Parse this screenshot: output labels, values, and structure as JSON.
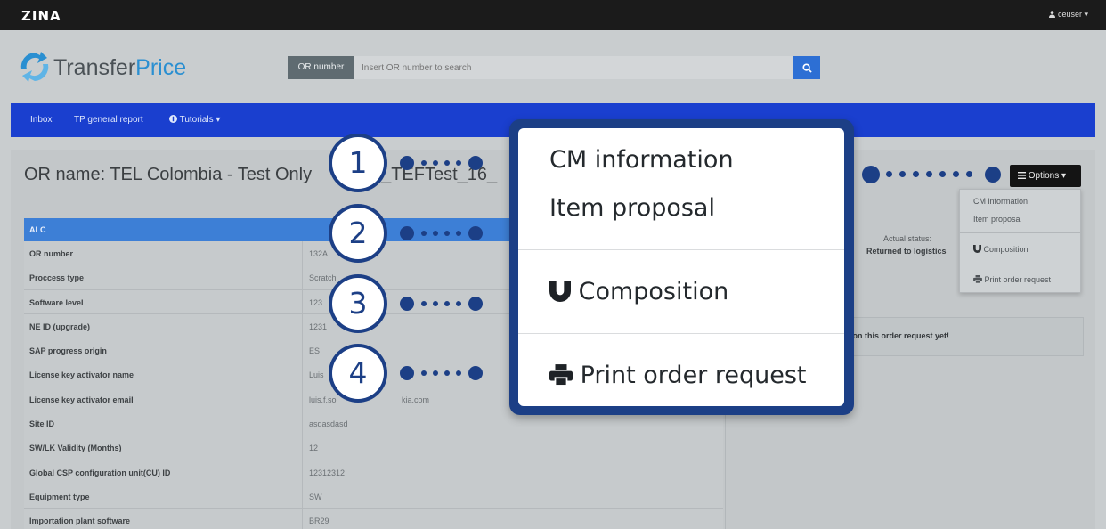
{
  "topbar": {
    "brand": "ZINA",
    "user": "ceuser ▾"
  },
  "header": {
    "logo_part1": "Transfer",
    "logo_part2": "Price",
    "search_label": "OR number",
    "search_placeholder": "Insert OR number to search"
  },
  "nav": {
    "inbox": "Inbox",
    "report": "TP general report",
    "tutorials": "Tutorials ▾"
  },
  "page": {
    "or_title": "OR name: TEL Colombia - Test Only",
    "or_title_tail": "_TEFTest_16_"
  },
  "table": {
    "header": "ALC",
    "rows": [
      {
        "key": "OR number",
        "value": "132A"
      },
      {
        "key": "Proccess type",
        "value": "Scratch"
      },
      {
        "key": "Software level",
        "value": "123"
      },
      {
        "key": "NE ID (upgrade)",
        "value": "1231"
      },
      {
        "key": "SAP progress origin",
        "value": "ES"
      },
      {
        "key": "License key activator name",
        "value": "Luis"
      },
      {
        "key": "License key activator email",
        "value": "luis.f.so"
      },
      {
        "key": "Site ID",
        "value": "asdasdasd"
      },
      {
        "key": "SW/LK Validity (Months)",
        "value": "12"
      },
      {
        "key": "Global CSP configuration unit(CU) ID",
        "value": "12312312"
      },
      {
        "key": "Equipment type",
        "value": "SW"
      },
      {
        "key": "Importation plant software",
        "value": "BR29"
      }
    ],
    "email_tail": "kia.com"
  },
  "status": {
    "label": "Actual status:",
    "value": "Returned to logistics"
  },
  "comments": {
    "text": "ts on this order request yet!"
  },
  "options": {
    "button_label": "Options ▾",
    "items": {
      "cm_information": "CM information",
      "item_proposal": "Item proposal",
      "composition": "Composition",
      "print": "Print order request"
    }
  },
  "steps": [
    "1",
    "2",
    "3",
    "4"
  ],
  "colors": {
    "nav": "#1a3fcf",
    "callout": "#1c3f86",
    "search_button": "#2d6fd4"
  }
}
